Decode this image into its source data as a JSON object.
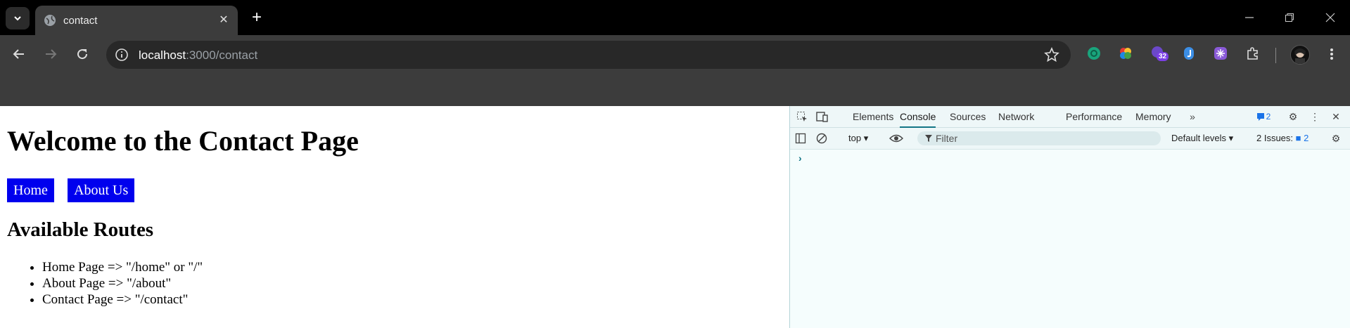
{
  "browser": {
    "tab_title": "contact",
    "url_host": "localhost",
    "url_path": ":3000/contact",
    "extension_badge": "32"
  },
  "page": {
    "heading": "Welcome to the Contact Page",
    "nav_buttons": [
      "Home",
      "About Us"
    ],
    "routes_heading": "Available Routes",
    "routes": [
      "Home Page => \"/home\" or \"/\"",
      "About Page => \"/about\"",
      "Contact Page => \"/contact\""
    ]
  },
  "devtools": {
    "tabs": [
      "Elements",
      "Console",
      "Sources",
      "Network",
      "Performance",
      "Memory"
    ],
    "active_tab": "Console",
    "messages_count": "2",
    "context": "top",
    "filter_placeholder": "Filter",
    "levels": "Default levels",
    "issues_label": "2 Issues:",
    "issues_count": "2",
    "prompt": "›"
  }
}
